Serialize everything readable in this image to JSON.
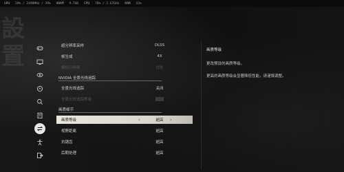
{
  "topbar": {
    "gpu": "GPU",
    "gpu_stats": "59% / 2490MHz / 39%",
    "vram": "VRAM",
    "vram_stats": "9.7GB",
    "cpu": "CPU",
    "cpu_stats": "70% / 2.67GHz",
    "ram": "RAM",
    "ram_stats": "43%"
  },
  "nav": {
    "items": [
      {
        "icon": "gamepad-icon"
      },
      {
        "icon": "display-icon"
      },
      {
        "icon": "eye-icon"
      },
      {
        "icon": "audio-icon"
      },
      {
        "icon": "search-icon"
      },
      {
        "icon": "document-icon"
      },
      {
        "icon": "swap-icon",
        "active": true
      },
      {
        "icon": "figure-icon"
      },
      {
        "icon": "exit-icon"
      }
    ]
  },
  "settings": {
    "rows_top": [
      {
        "label": "超分辨率采样",
        "value": "DLSS",
        "disabled": false
      },
      {
        "label": "帧生成",
        "value": "4X",
        "disabled": false
      },
      {
        "label": "模拟分辨率",
        "value": "优先",
        "disabled": true
      }
    ],
    "section1": "NVIDIA 全景光线追踪",
    "rows_mid": [
      {
        "label": "全景光线追踪",
        "value": "关闭",
        "disabled": false
      },
      {
        "label": "全景光线追踪等级",
        "value": "",
        "disabled": true
      }
    ],
    "section2": "画质细节",
    "selected": {
      "label": "画质等级",
      "value": "超高",
      "left_arrow": "‹",
      "right_arrow": "›"
    },
    "rows_bottom": [
      {
        "label": "视野距离",
        "value": "超高"
      },
      {
        "label": "抗锯齿",
        "value": "超高"
      },
      {
        "label": "后期处理",
        "value": "超高"
      }
    ]
  },
  "detail": {
    "title": "画质等级",
    "line1": "更改预设的画质等级。",
    "line2": "更高的画质等级会显著降低性能，请谨慎调整。"
  },
  "bg": {
    "calligraphy": "設\n置"
  }
}
